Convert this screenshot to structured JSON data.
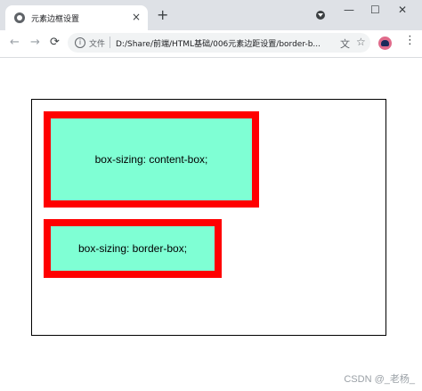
{
  "tab": {
    "title": "元素边框设置",
    "close_glyph": "×",
    "new_tab_glyph": "+"
  },
  "window_controls": {
    "minimize": "—",
    "maximize": "☐",
    "close": "✕"
  },
  "toolbar": {
    "back_glyph": "←",
    "forward_glyph": "→",
    "reload_glyph": "⟳",
    "info_glyph": "i",
    "file_label": "文件",
    "url": "D:/Share/前端/HTML基础/006元素边距设置/border-b...",
    "translate_glyph": "文",
    "star_glyph": "☆",
    "menu_glyph": "⋮"
  },
  "page": {
    "box1_text": "box-sizing: content-box;",
    "box2_text": "box-sizing: border-box;"
  },
  "watermark": "CSDN @_老杨_",
  "colors": {
    "box_background": "#7fffd4",
    "box_border": "#ff0000"
  }
}
